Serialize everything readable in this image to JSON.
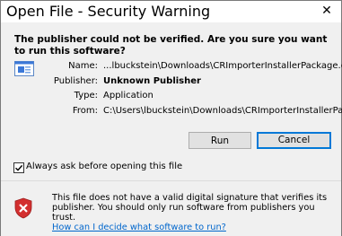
{
  "window": {
    "title": "Open File - Security Warning",
    "close_glyph": "✕"
  },
  "question": "The publisher could not be verified.  Are you sure you want to run this software?",
  "details": {
    "name_label": "Name:",
    "name_value": "...lbuckstein\\Downloads\\CRImporterInstallerPackage.exe",
    "publisher_label": "Publisher:",
    "publisher_value": "Unknown Publisher",
    "type_label": "Type:",
    "type_value": "Application",
    "from_label": "From:",
    "from_value": "C:\\Users\\lbuckstein\\Downloads\\CRImporterInstallerPa..."
  },
  "buttons": {
    "run": "Run",
    "cancel": "Cancel"
  },
  "checkbox": {
    "label": "Always ask before opening this file",
    "checked": true
  },
  "footer": {
    "warning": "This file does not have a valid digital signature that verifies its publisher.  You should only run software from publishers you trust.",
    "link": "How can I decide what software to run?"
  },
  "icons": {
    "file": "application-file-icon",
    "shield": "shield-warning-icon",
    "close": "close-icon"
  },
  "colors": {
    "link": "#0066cc",
    "default_button_border": "#0078d7",
    "shield_red": "#d32f2f"
  }
}
